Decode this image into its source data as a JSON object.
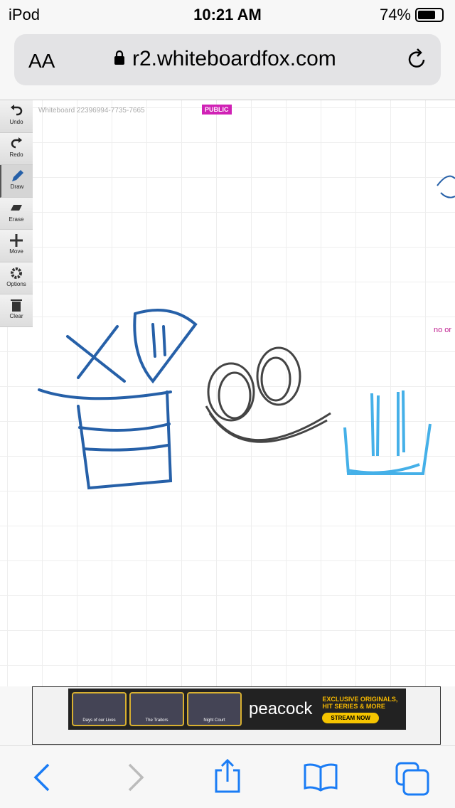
{
  "status": {
    "device": "iPod",
    "time": "10:21 AM",
    "battery": "74%"
  },
  "browser": {
    "text_size": "AA",
    "url": "r2.whiteboardfox.com"
  },
  "toolbar": [
    {
      "label": "Undo"
    },
    {
      "label": "Redo"
    },
    {
      "label": "Draw"
    },
    {
      "label": "Erase"
    },
    {
      "label": "Move"
    },
    {
      "label": "Options"
    },
    {
      "label": "Clear"
    }
  ],
  "board": {
    "title": "Whiteboard 22396994-7735-7665",
    "badge": "PUBLIC",
    "edge_text": "no or"
  },
  "ad": {
    "thumbs": [
      "Days of our Lives",
      "The Traitors",
      "Night Court"
    ],
    "brand": "peacock",
    "headline": "EXCLUSIVE ORIGINALS, HIT SERIES & MORE",
    "cta": "STREAM NOW"
  },
  "colors": {
    "accent": "#1a7cf5",
    "badge": "#d021b5",
    "ink_blue": "#2660a8",
    "ink_gray": "#444444",
    "ink_light": "#45b0e8"
  }
}
